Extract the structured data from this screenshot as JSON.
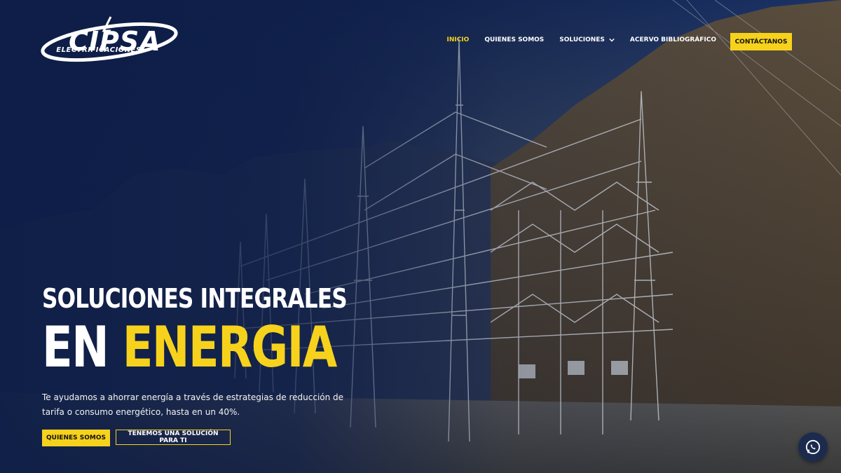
{
  "brand": {
    "logo_text": "CIPSA",
    "subtitle": "ELECTRIFICACIONES"
  },
  "nav": {
    "items": [
      {
        "label": "INICIO",
        "active": true
      },
      {
        "label": "QUIENES SOMOS",
        "active": false
      },
      {
        "label": "SOLUCIONES",
        "active": false,
        "has_dropdown": true
      },
      {
        "label": "ACERVO BIBLIOGRÁFICO",
        "active": false
      }
    ],
    "cta": "CONTÁCTANOS"
  },
  "hero": {
    "title_line1": "SOLUCIONES INTEGRALES",
    "title_line2_white": "EN",
    "title_line2_accent": "ENERGIA",
    "lead": "Te ayudamos a ahorrar energía a través de estrategias de reducción de tarifa o consumo energético, hasta en un 40%.",
    "btn_primary": "QUIENES SOMOS",
    "btn_secondary": "TENEMOS UNA SOLUCIÓN PARA TI"
  },
  "floating": {
    "icon": "whatsapp-icon"
  },
  "colors": {
    "accent": "#f7d21c",
    "navy": "#0e1e48"
  }
}
